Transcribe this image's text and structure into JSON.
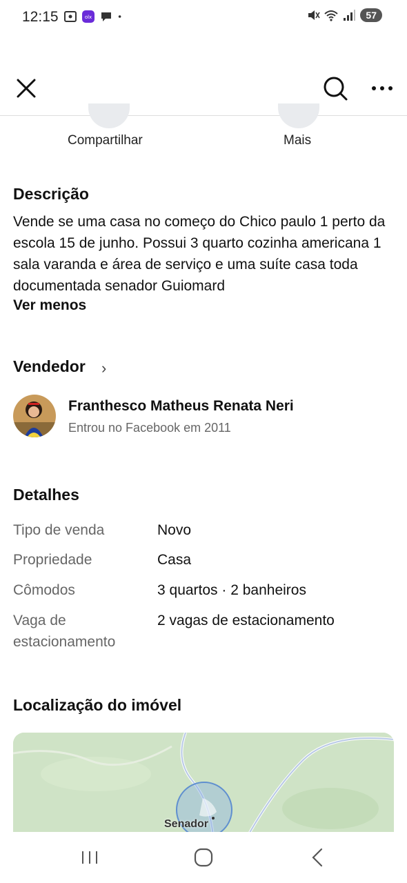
{
  "status_bar": {
    "time": "12:15",
    "battery": "57",
    "icons": [
      "screenshot-icon",
      "app-notification-icon",
      "chat-bubble-icon",
      "dot-icon",
      "mute-icon",
      "wifi-icon",
      "signal-icon"
    ]
  },
  "toolbar": {
    "icons": [
      "close-icon",
      "search-icon",
      "more-options-icon"
    ]
  },
  "actions": {
    "share_label": "Compartilhar",
    "more_label": "Mais"
  },
  "description": {
    "title": "Descrição",
    "text": "Vende se uma casa no começo do Chico paulo 1 perto da escola 15 de junho. Possui 3 quarto cozinha americana 1 sala varanda e área de serviço e uma suíte casa toda documentada senador Guiomard",
    "toggle_label": "Ver menos"
  },
  "seller": {
    "title": "Vendedor",
    "name": "Franthesco Matheus Renata Neri",
    "joined": "Entrou no Facebook em 2011"
  },
  "details": {
    "title": "Detalhes",
    "rows": [
      {
        "label": "Tipo de venda",
        "value": "Novo"
      },
      {
        "label": "Propriedade",
        "value": "Casa"
      },
      {
        "label": "Cômodos",
        "value": "3 quartos · 2 banheiros"
      },
      {
        "label": "Vaga de estacionamento",
        "value": "2 vagas de estacionamento"
      }
    ]
  },
  "location": {
    "title": "Localização do imóvel",
    "map_label": "Senador"
  },
  "nav": {
    "icons": [
      "recent-apps-icon",
      "home-icon",
      "back-icon"
    ]
  },
  "colors": {
    "map_green": "#cfe3c6",
    "map_circle": "#8fb3e0",
    "muted_text": "#666666"
  }
}
